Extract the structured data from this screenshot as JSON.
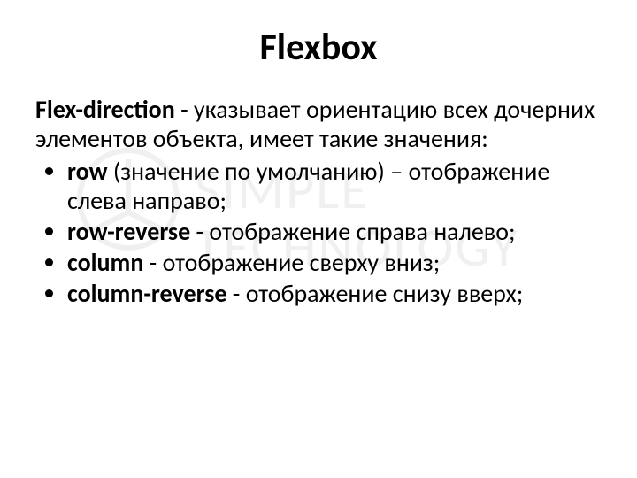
{
  "title": "Flexbox",
  "watermark": {
    "line1": "SIMPLE",
    "line2": "TECHNOLOGY"
  },
  "lead": {
    "term": "Flex-direction",
    "text": " - указывает ориентацию всех дочерних элементов объекта, имеет такие значения:"
  },
  "items": [
    {
      "kw": "row",
      "desc": " (значение по умолчанию) – отображение слева направо;"
    },
    {
      "kw": "row-reverse",
      "desc": " - отображение справа налево;"
    },
    {
      "kw": "column",
      "desc": " - отображение сверху вниз;"
    },
    {
      "kw": "column-reverse",
      "desc": " - отображение снизу вверх;"
    }
  ]
}
